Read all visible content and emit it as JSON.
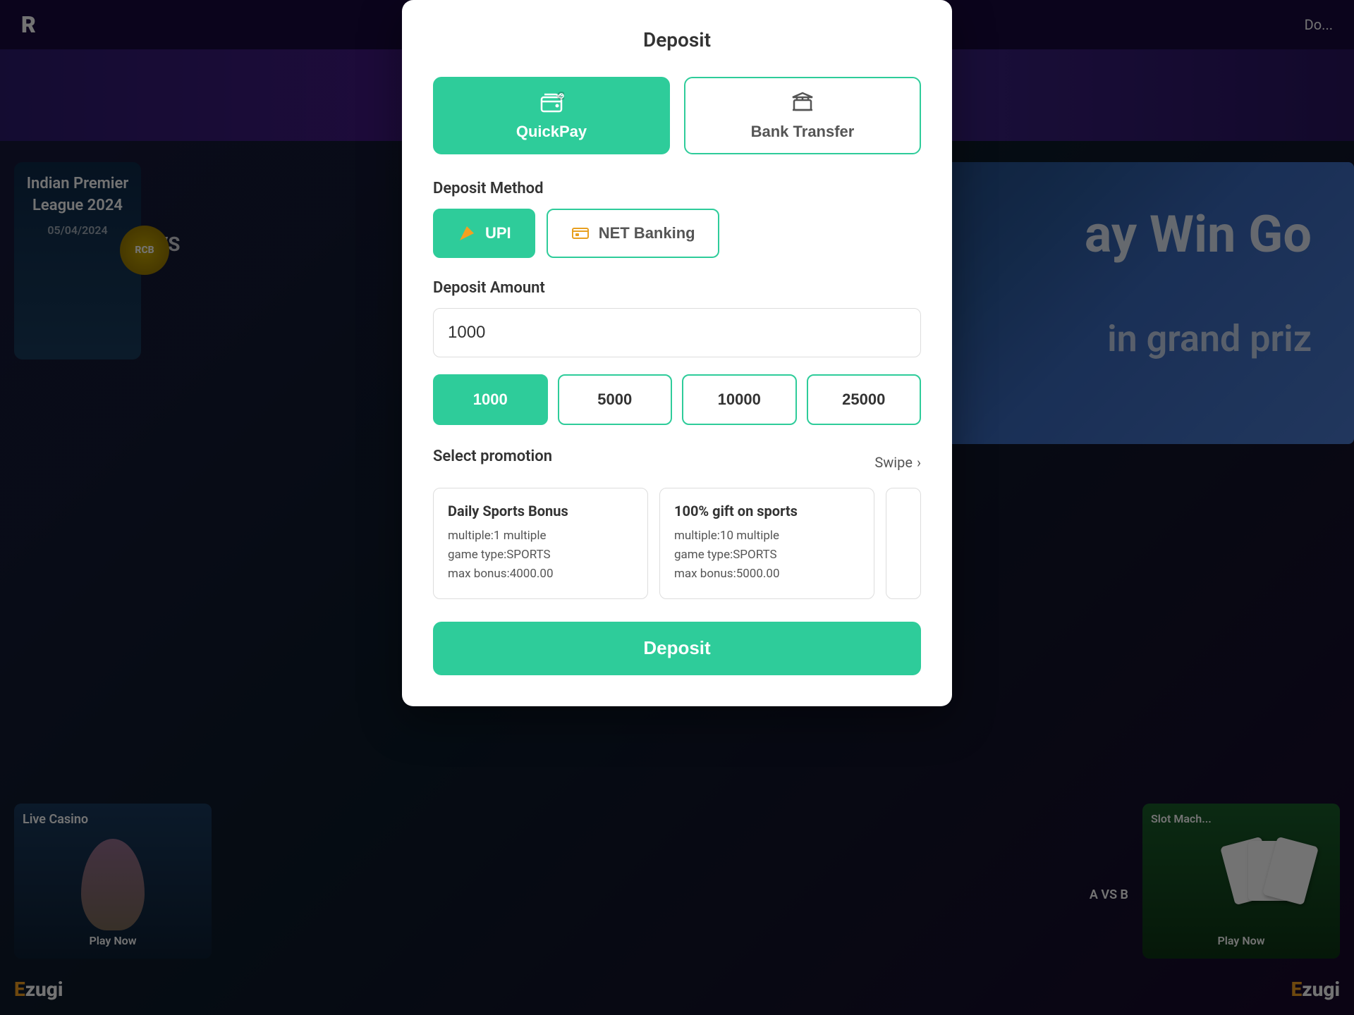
{
  "background": {
    "nav": {
      "logo": "R",
      "right_label": "Do..."
    },
    "banner": {
      "line1": "ay Win Go",
      "line2": "in grand priz"
    },
    "left_card": {
      "title": "Indian Premier League 2024",
      "date": "05/04/2024",
      "vs": "VS"
    },
    "live_casino": {
      "label": "Live Casino",
      "play": "Play Now"
    },
    "ezugi_left": "zugi",
    "ezugi_right": "zugi",
    "slot_label": "Slot Mach...",
    "slot_play": "Play Now",
    "avs_label": "A VS B"
  },
  "modal": {
    "title": "Deposit",
    "payment_methods": [
      {
        "id": "quickpay",
        "label": "QuickPay",
        "icon": "wallet-icon",
        "active": true
      },
      {
        "id": "bank_transfer",
        "label": "Bank Transfer",
        "icon": "bank-icon",
        "active": false
      }
    ],
    "deposit_method_label": "Deposit Method",
    "deposit_methods": [
      {
        "id": "upi",
        "label": "UPI",
        "icon": "upi-icon",
        "active": true
      },
      {
        "id": "net_banking",
        "label": "NET Banking",
        "icon": "net-banking-icon",
        "active": false
      }
    ],
    "deposit_amount_label": "Deposit Amount",
    "deposit_amount_value": "1000",
    "quick_amounts": [
      {
        "value": "1000",
        "selected": true
      },
      {
        "value": "5000",
        "selected": false
      },
      {
        "value": "10000",
        "selected": false
      },
      {
        "value": "25000",
        "selected": false
      }
    ],
    "select_promotion_label": "Select promotion",
    "swipe_label": "Swipe",
    "promotions": [
      {
        "title": "Daily Sports Bonus",
        "multiple": "multiple:1 multiple",
        "game_type": "game type:SPORTS",
        "max_bonus": "max bonus:4000.00"
      },
      {
        "title": "100% gift on sports",
        "multiple": "multiple:10 multiple",
        "game_type": "game type:SPORTS",
        "max_bonus": "max bonus:5000.00"
      }
    ],
    "deposit_button_label": "Deposit"
  }
}
